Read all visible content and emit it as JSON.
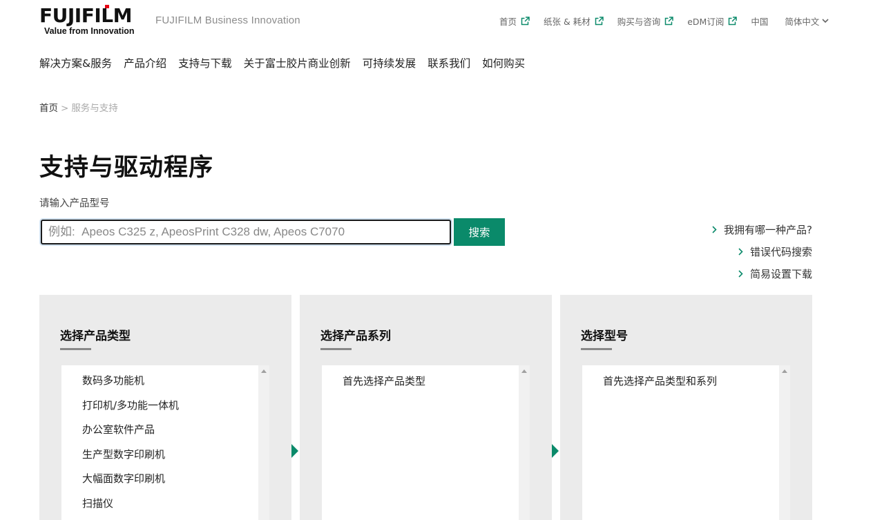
{
  "brand": {
    "logo_text": "FUJIFILM",
    "tagline": "Value from Innovation",
    "subtitle": "FUJIFILM Business Innovation"
  },
  "util_nav": {
    "items": [
      {
        "label": "首页"
      },
      {
        "label": "纸张 & 耗材"
      },
      {
        "label": "购买与咨询"
      },
      {
        "label": "eDM订阅"
      }
    ],
    "region": "中国",
    "language": "简体中文"
  },
  "main_nav": {
    "items": [
      "解决方案&服务",
      "产品介绍",
      "支持与下载",
      "关于富士胶片商业创新",
      "可持续发展",
      "联系我们",
      "如何购买"
    ]
  },
  "breadcrumb": {
    "home": "首页",
    "separator": ">",
    "current": "服务与支持"
  },
  "page": {
    "title": "支持与驱动程序",
    "search_label": "请输入产品型号",
    "search_placeholder": "例如:  Apeos C325 z, ApeosPrint C328 dw, Apeos C7070",
    "search_button": "搜索"
  },
  "side_links": [
    "我拥有哪一种产品?",
    "错误代码搜索",
    "简易设置下载"
  ],
  "panels": {
    "type": {
      "title": "选择产品类型",
      "items": [
        "数码多功能机",
        "打印机/多功能一体机",
        "办公室软件产品",
        "生产型数字印刷机",
        "大幅面数字印刷机",
        "扫描仪"
      ]
    },
    "series": {
      "title": "选择产品系列",
      "placeholder": "首先选择产品类型"
    },
    "model": {
      "title": "选择型号",
      "placeholder": "首先选择产品类型和系列"
    }
  },
  "colors": {
    "accent": "#0a8a6a",
    "panel_bg": "#ebebeb",
    "logo_dot": "#e60012"
  }
}
